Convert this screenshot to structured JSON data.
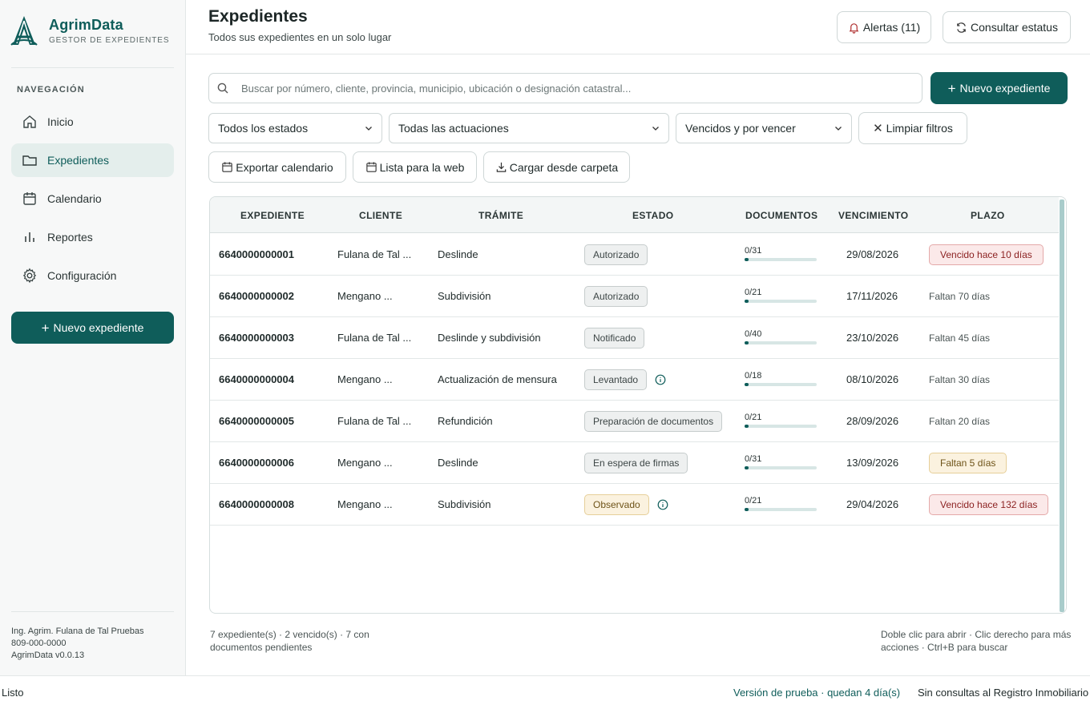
{
  "brand": {
    "name": "AgrimData",
    "subtitle": "GESTOR DE EXPEDIENTES"
  },
  "nav": {
    "heading": "NAVEGACIÓN",
    "items": [
      {
        "label": "Inicio",
        "icon": "home-icon",
        "active": false
      },
      {
        "label": "Expedientes",
        "icon": "folder-icon",
        "active": true
      },
      {
        "label": "Calendario",
        "icon": "calendar-icon",
        "active": false
      },
      {
        "label": "Reportes",
        "icon": "bar-chart-icon",
        "active": false
      },
      {
        "label": "Configuración",
        "icon": "gear-icon",
        "active": false
      }
    ],
    "new_button": "Nuevo expediente"
  },
  "user": {
    "name": "Ing. Agrim. Fulana de Tal Pruebas",
    "phone": "809-000-0000",
    "version": "AgrimData v0.0.13"
  },
  "header": {
    "title": "Expedientes",
    "subtitle": "Todos sus expedientes en un solo lugar",
    "alerts_label": "Alertas (11)",
    "status_label": "Consultar estatus"
  },
  "search": {
    "placeholder": "Buscar por número, cliente, provincia, municipio, ubicación o designación catastral...",
    "value": ""
  },
  "new_button": "Nuevo expediente",
  "filters": {
    "estado": "Todos los estados",
    "actuacion": "Todas las actuaciones",
    "vencimiento": "Vencidos y por vencer",
    "clear_label": "Limpiar filtros"
  },
  "actions": {
    "export_calendar": "Exportar calendario",
    "web_list": "Lista para la web",
    "load_folder": "Cargar desde carpeta"
  },
  "table": {
    "columns": [
      "EXPEDIENTE",
      "CLIENTE",
      "TRÁMITE",
      "ESTADO",
      "DOCUMENTOS",
      "VENCIMIENTO",
      "PLAZO"
    ],
    "rows": [
      {
        "expediente": "6640000000001",
        "cliente": "Fulana de Tal ...",
        "tramite": "Deslinde",
        "estado": "Autorizado",
        "estado_style": "neutral",
        "info": false,
        "documentos": "0/31",
        "doc_progress": 0,
        "vencimiento": "29/08/2026",
        "plazo": "Vencido hace 10 días",
        "plazo_style": "red"
      },
      {
        "expediente": "6640000000002",
        "cliente": "Mengano ...",
        "tramite": "Subdivisión",
        "estado": "Autorizado",
        "estado_style": "neutral",
        "info": false,
        "documentos": "0/21",
        "doc_progress": 0,
        "vencimiento": "17/11/2026",
        "plazo": "Faltan 70 días",
        "plazo_style": "plain"
      },
      {
        "expediente": "6640000000003",
        "cliente": "Fulana de Tal ...",
        "tramite": "Deslinde y subdivisión",
        "estado": "Notificado",
        "estado_style": "neutral",
        "info": false,
        "documentos": "0/40",
        "doc_progress": 0,
        "vencimiento": "23/10/2026",
        "plazo": "Faltan 45 días",
        "plazo_style": "plain"
      },
      {
        "expediente": "6640000000004",
        "cliente": "Mengano ...",
        "tramite": "Actualización de mensura",
        "estado": "Levantado",
        "estado_style": "neutral",
        "info": true,
        "documentos": "0/18",
        "doc_progress": 0,
        "vencimiento": "08/10/2026",
        "plazo": "Faltan 30 días",
        "plazo_style": "plain"
      },
      {
        "expediente": "6640000000005",
        "cliente": "Fulana de Tal ...",
        "tramite": "Refundición",
        "estado": "Preparación de documentos",
        "estado_style": "neutral",
        "info": false,
        "documentos": "0/21",
        "doc_progress": 0,
        "vencimiento": "28/09/2026",
        "plazo": "Faltan 20 días",
        "plazo_style": "plain"
      },
      {
        "expediente": "6640000000006",
        "cliente": "Mengano ...",
        "tramite": "Deslinde",
        "estado": "En espera de firmas",
        "estado_style": "neutral",
        "info": false,
        "documentos": "0/31",
        "doc_progress": 0,
        "vencimiento": "13/09/2026",
        "plazo": "Faltan 5 días",
        "plazo_style": "amber"
      },
      {
        "expediente": "6640000000008",
        "cliente": "Mengano ...",
        "tramite": "Subdivisión",
        "estado": "Observado",
        "estado_style": "observed",
        "info": true,
        "documentos": "0/21",
        "doc_progress": 0,
        "vencimiento": "29/04/2026",
        "plazo": "Vencido hace 132 días",
        "plazo_style": "red"
      }
    ]
  },
  "footer": {
    "summary": "7 expediente(s) · 2 vencido(s) · 7 con documentos pendientes",
    "hint": "Doble clic para abrir · Clic derecho para más acciones · Ctrl+B para buscar"
  },
  "statusbar": {
    "left": "Listo",
    "trial": "Versión de prueba · quedan 4 día(s)",
    "registry": "Sin consultas al Registro Inmobiliario"
  },
  "colors": {
    "primary": "#0f5d5a",
    "danger_bg": "#fbe9e9",
    "warning_bg": "#fbf2df"
  }
}
